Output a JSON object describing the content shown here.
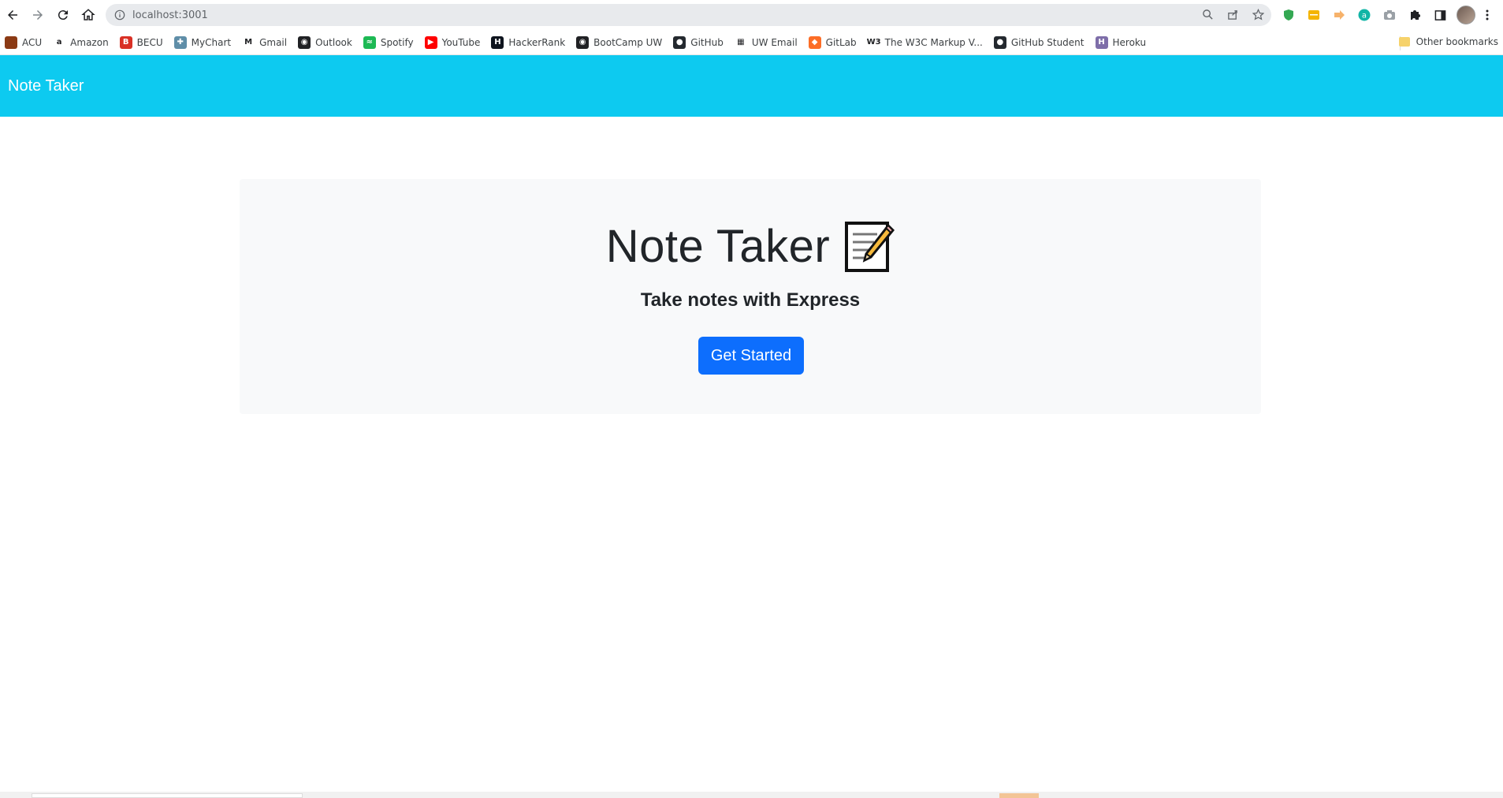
{
  "browser": {
    "url": "localhost:3001",
    "bookmarks": [
      {
        "label": "ACU",
        "icon": "acu-favicon",
        "color": "#8b3a14",
        "glyph": ""
      },
      {
        "label": "Amazon",
        "icon": "amazon-favicon",
        "color": "#ffffff",
        "glyph": "a"
      },
      {
        "label": "BECU",
        "icon": "becu-favicon",
        "color": "#d93025",
        "glyph": "B"
      },
      {
        "label": "MyChart",
        "icon": "mychart-favicon",
        "color": "#5f8ea8",
        "glyph": "✚"
      },
      {
        "label": "Gmail",
        "icon": "gmail-favicon",
        "color": "#ffffff",
        "glyph": "M"
      },
      {
        "label": "Outlook",
        "icon": "globe-favicon",
        "color": "#202124",
        "glyph": "◉"
      },
      {
        "label": "Spotify",
        "icon": "spotify-favicon",
        "color": "#1db954",
        "glyph": "≈"
      },
      {
        "label": "YouTube",
        "icon": "youtube-favicon",
        "color": "#ff0000",
        "glyph": "▶"
      },
      {
        "label": "HackerRank",
        "icon": "hackerrank-favicon",
        "color": "#0e141e",
        "glyph": "H"
      },
      {
        "label": "BootCamp UW",
        "icon": "globe-favicon",
        "color": "#202124",
        "glyph": "◉"
      },
      {
        "label": "GitHub",
        "icon": "github-favicon",
        "color": "#24292f",
        "glyph": "●"
      },
      {
        "label": "UW Email",
        "icon": "microsoft-favicon",
        "color": "#ffffff",
        "glyph": "▦"
      },
      {
        "label": "GitLab",
        "icon": "gitlab-favicon",
        "color": "#fc6d26",
        "glyph": "◆"
      },
      {
        "label": "The W3C Markup V...",
        "icon": "w3c-favicon",
        "color": "#ffffff",
        "glyph": "W3"
      },
      {
        "label": "GitHub Student",
        "icon": "github-favicon",
        "color": "#24292f",
        "glyph": "●"
      },
      {
        "label": "Heroku",
        "icon": "heroku-favicon",
        "color": "#7e6ea9",
        "glyph": "H"
      }
    ],
    "other_bookmarks": "Other bookmarks"
  },
  "navbar": {
    "brand": "Note Taker",
    "color": "#0dcaf0"
  },
  "jumbotron": {
    "title": "Note Taker",
    "title_icon": "memo-icon",
    "lead": "Take notes with Express",
    "button_label": "Get Started",
    "button_color": "#0d6efd"
  }
}
